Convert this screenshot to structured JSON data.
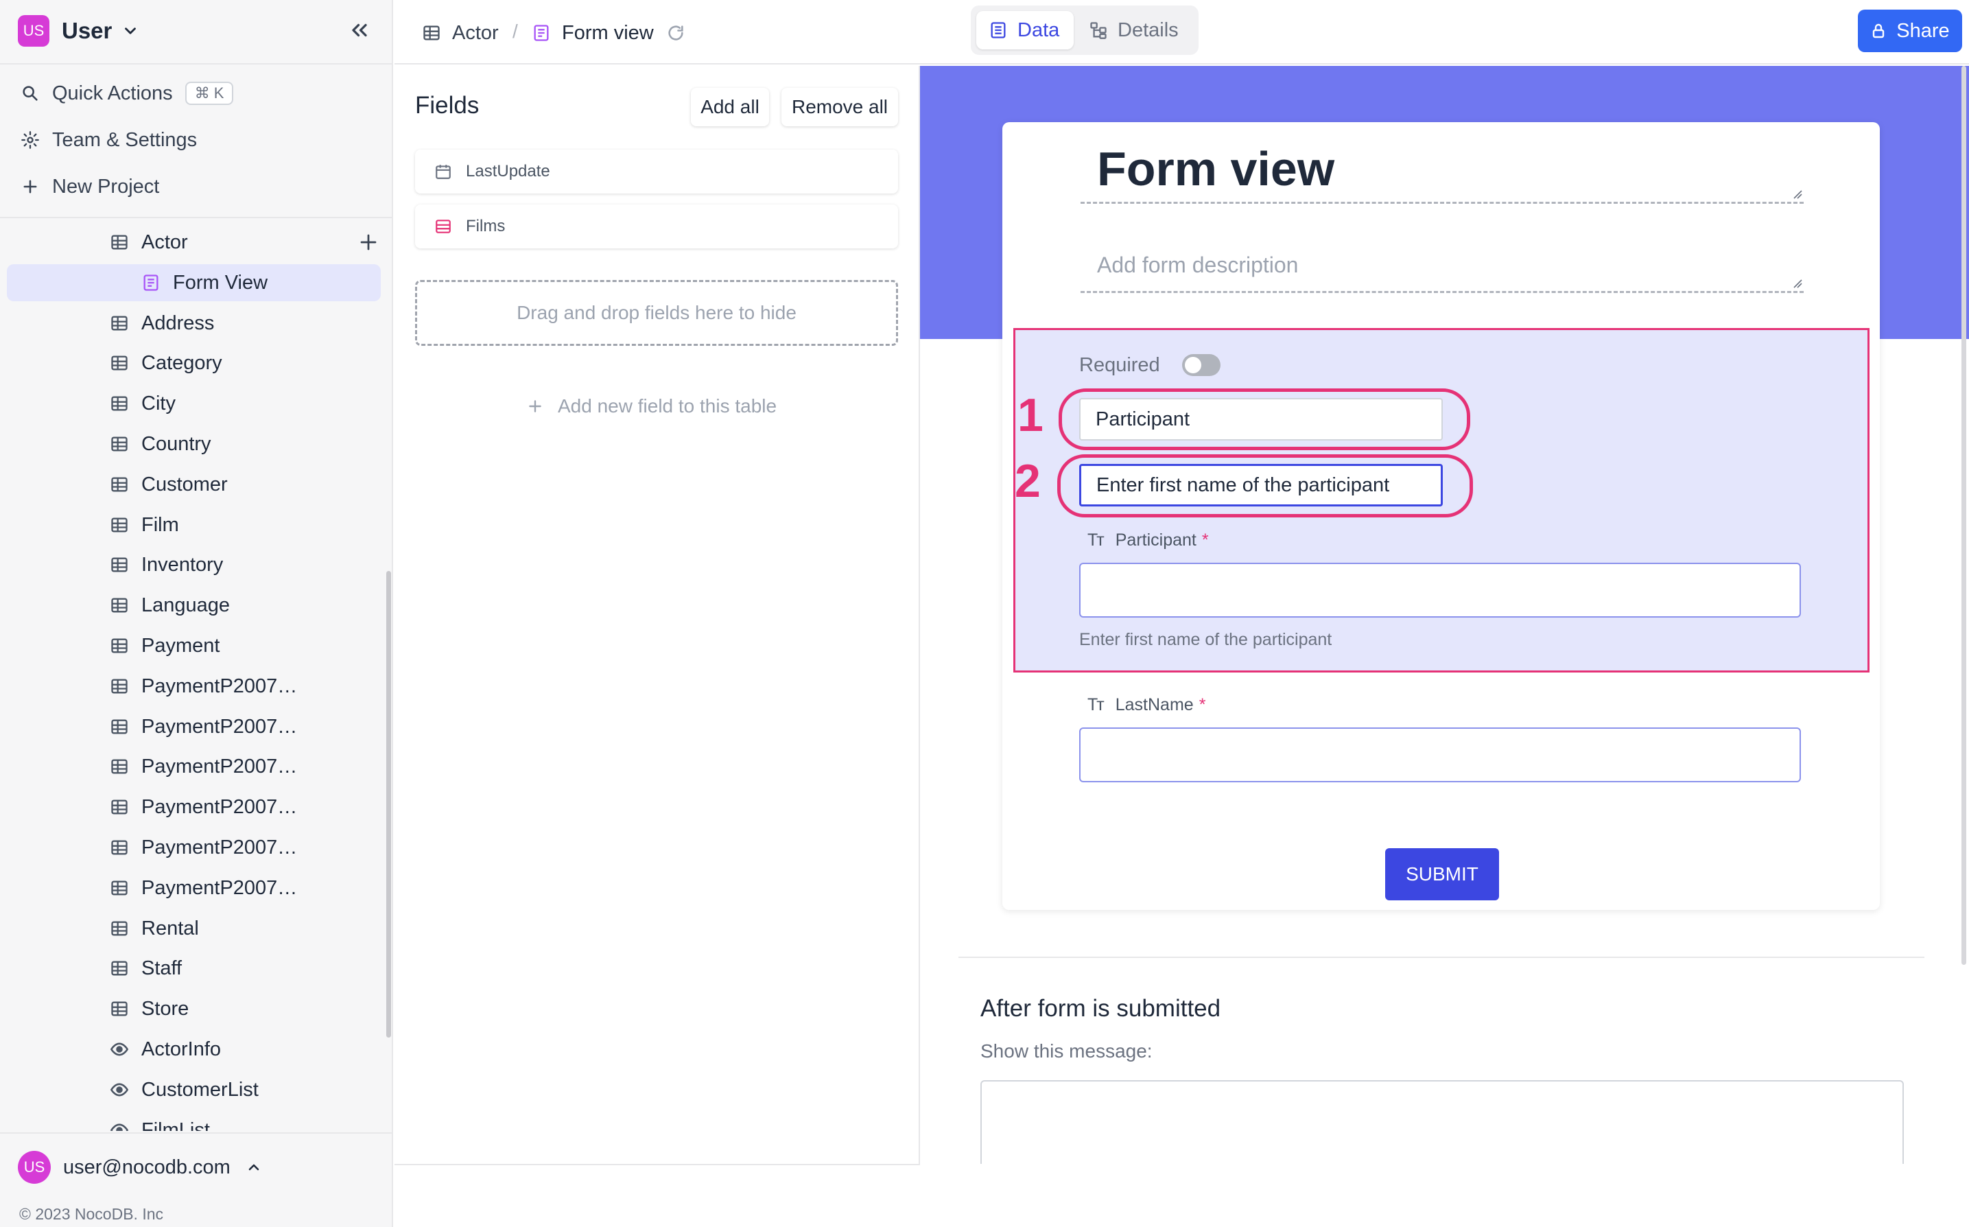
{
  "workspace": {
    "badge": "US",
    "name": "User"
  },
  "sidebar": {
    "actions": [
      {
        "label": "Quick Actions",
        "shortcut": "⌘ K",
        "icon": "search-icon"
      },
      {
        "label": "Team & Settings",
        "icon": "gear-icon"
      },
      {
        "label": "New Project",
        "icon": "plus-icon"
      }
    ],
    "tables": [
      {
        "label": "Actor",
        "icon": "table-icon"
      },
      {
        "label": "Form View",
        "icon": "form-icon",
        "active": true
      },
      {
        "label": "Address",
        "icon": "table-icon"
      },
      {
        "label": "Category",
        "icon": "table-icon"
      },
      {
        "label": "City",
        "icon": "table-icon"
      },
      {
        "label": "Country",
        "icon": "table-icon"
      },
      {
        "label": "Customer",
        "icon": "table-icon"
      },
      {
        "label": "Film",
        "icon": "table-icon"
      },
      {
        "label": "Inventory",
        "icon": "table-icon"
      },
      {
        "label": "Language",
        "icon": "table-icon"
      },
      {
        "label": "Payment",
        "icon": "table-icon"
      },
      {
        "label": "PaymentP2007…",
        "icon": "table-icon"
      },
      {
        "label": "PaymentP2007…",
        "icon": "table-icon"
      },
      {
        "label": "PaymentP2007…",
        "icon": "table-icon"
      },
      {
        "label": "PaymentP2007…",
        "icon": "table-icon"
      },
      {
        "label": "PaymentP2007…",
        "icon": "table-icon"
      },
      {
        "label": "PaymentP2007…",
        "icon": "table-icon"
      },
      {
        "label": "Rental",
        "icon": "table-icon"
      },
      {
        "label": "Staff",
        "icon": "table-icon"
      },
      {
        "label": "Store",
        "icon": "table-icon"
      },
      {
        "label": "ActorInfo",
        "icon": "eye-icon"
      },
      {
        "label": "CustomerList",
        "icon": "eye-icon"
      },
      {
        "label": "FilmList",
        "icon": "eye-icon"
      }
    ],
    "user": {
      "badge": "US",
      "email": "user@nocodb.com"
    },
    "copyright": "© 2023 NocoDB. Inc"
  },
  "topbar": {
    "breadcrumb": [
      "Actor",
      "/",
      "Form view"
    ],
    "tabs": [
      "Data",
      "Details"
    ],
    "share_label": "Share"
  },
  "fields_panel": {
    "title": "Fields",
    "add_all": "Add all",
    "remove_all": "Remove all",
    "hidden_fields": [
      {
        "label": "LastUpdate",
        "icon": "calendar-icon"
      },
      {
        "label": "Films",
        "icon": "link-icon"
      }
    ],
    "drop_hint": "Drag and drop fields here to hide",
    "add_field": "Add new field to this table"
  },
  "form": {
    "title": "Form view",
    "description_placeholder": "Add form description",
    "required_label": "Required",
    "required_on": false,
    "editing_label_value": "Participant",
    "editing_help_value": "Enter first name of the participant",
    "callouts": [
      "1",
      "2"
    ],
    "fields": [
      {
        "label": "Participant",
        "required_mark": "*",
        "help": "Enter first name of the participant"
      },
      {
        "label": "LastName",
        "required_mark": "*"
      }
    ],
    "field_type_glyph": "Tт",
    "submit_label": "SUBMIT",
    "after_title": "After form is submitted",
    "after_sub": "Show this message:"
  },
  "colors": {
    "accent": "#3c47e1",
    "banner": "#7077f0",
    "highlight": "#e53276",
    "share": "#3268f4",
    "badge": "#d63bd6"
  }
}
